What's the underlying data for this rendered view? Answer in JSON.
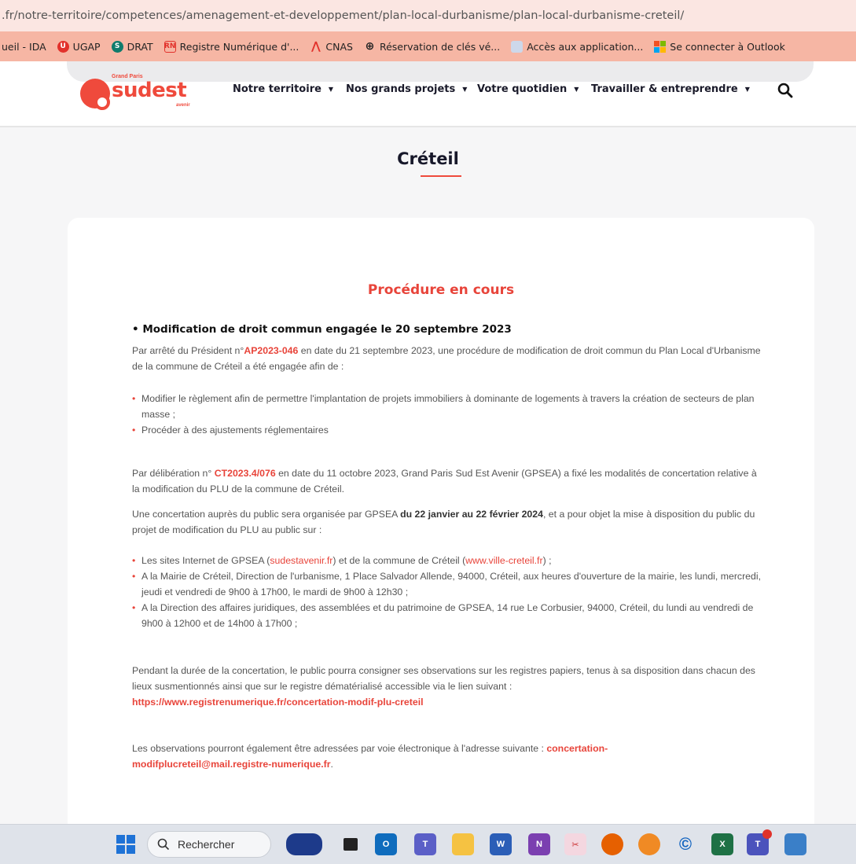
{
  "browser": {
    "url": ".fr/notre-territoire/competences/amenagement-et-developpement/plan-local-durbanisme/plan-local-durbanisme-creteil/",
    "bookmarks": [
      {
        "label": "ueil - IDA",
        "icon": "none"
      },
      {
        "label": "UGAP",
        "icon": "ugap-icon",
        "color": "#e2312b"
      },
      {
        "label": "DRAT",
        "icon": "sharepoint-icon",
        "color": "#0f7b6c"
      },
      {
        "label": "Registre Numérique d'...",
        "icon": "registre-icon",
        "color": "#e2312b"
      },
      {
        "label": "CNAS",
        "icon": "cnas-icon",
        "color": "#e2312b"
      },
      {
        "label": "Réservation de clés vé...",
        "icon": "globe-icon",
        "color": "#222222"
      },
      {
        "label": "Accès aux application...",
        "icon": "app-icon",
        "color": "#9fb6d8"
      },
      {
        "label": "Se connecter à Outlook",
        "icon": "microsoft-icon",
        "color": "#f25022"
      }
    ]
  },
  "header": {
    "logo": {
      "top": "Grand Paris",
      "main": "sudest",
      "bottom": "avenir"
    },
    "nav": [
      "Notre territoire",
      "Nos grands projets",
      "Votre quotidien",
      "Travailler & entreprendre"
    ]
  },
  "page": {
    "title": "Créteil",
    "section_title": "Procédure en cours",
    "heading": "• Modification de droit commun engagée le 20 septembre 2023",
    "p1_a": "Par arrêté du Président n°",
    "p1_ref": "AP2023-046",
    "p1_b": " en date du 21 septembre 2023, une procédure de modification de droit commun du Plan Local d'Urbanisme de la commune de Créteil a été engagée afin de :",
    "list1": [
      "Modifier le règlement afin de permettre l'implantation de projets immobiliers à dominante de logements à travers la création de secteurs de plan masse ;",
      "Procéder à des ajustements réglementaires"
    ],
    "p2_a": "Par délibération n° ",
    "p2_ref": "CT2023.4/076",
    "p2_b": " en date du 11 octobre 2023, Grand Paris Sud Est Avenir (GPSEA) a fixé les modalités de concertation relative à la modification du PLU de la commune de Créteil.",
    "p3_a": "Une concertation auprès du public sera organisée par GPSEA ",
    "p3_bold": "du 22 janvier au 22 février 2024",
    "p3_b": ", et a pour objet la mise à disposition du public du projet de modification du PLU au public sur :",
    "list2_item1_a": "Les sites Internet de GPSEA (",
    "list2_item1_link1": "sudestavenir.fr",
    "list2_item1_b": ") et de la commune de Créteil (",
    "list2_item1_link2": "www.ville-creteil.fr",
    "list2_item1_c": ") ;",
    "list2_item2": "A la Mairie de Créteil, Direction de l'urbanisme, 1 Place Salvador Allende, 94000, Créteil, aux heures d'ouverture de la mairie, les lundi, mercredi, jeudi et vendredi de 9h00 à 17h00, le mardi de 9h00 à 12h30 ;",
    "list2_item3": "A la Direction des affaires juridiques, des assemblées et du patrimoine de GPSEA, 14 rue Le Corbusier, 94000, Créteil, du lundi au vendredi de 9h00 à 12h00 et de 14h00 à 17h00 ;",
    "p4": "Pendant la durée de la concertation, le public pourra consigner ses observations sur les registres papiers, tenus à sa disposition dans chacun des lieux susmentionnés ainsi que sur le registre dématérialisé accessible via le lien suivant :",
    "p4_link": "https://www.registrenumerique.fr/concertation-modif-plu-creteil",
    "p5_a": "Les observations pourront également être adressées par voie électronique à l'adresse suivante : ",
    "p5_email_1": "concertation-",
    "p5_email_2": "modifplucreteil@mail.registre-numerique.fr",
    "p5_b": "."
  },
  "taskbar": {
    "search_label": "Rechercher"
  }
}
